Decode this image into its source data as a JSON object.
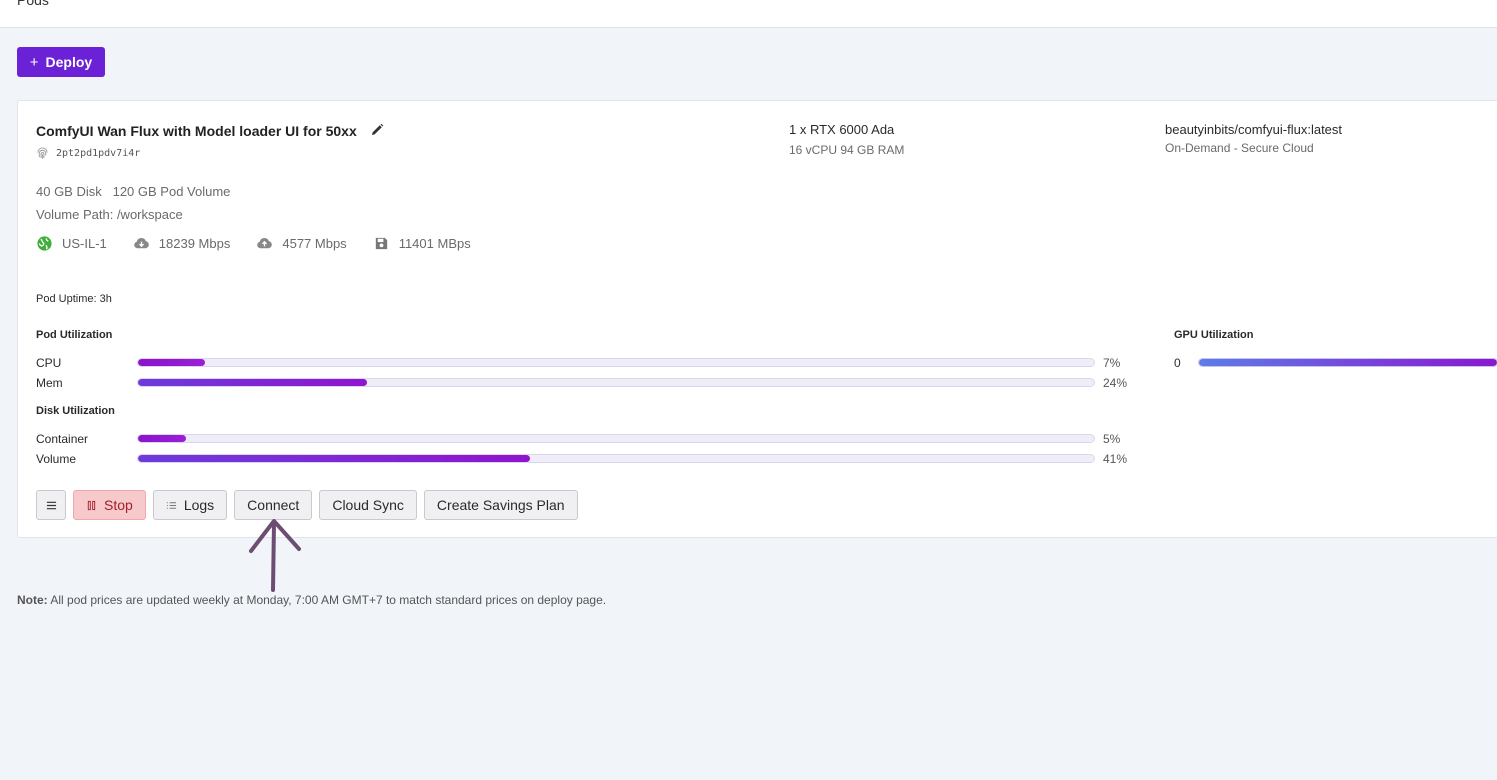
{
  "header": {
    "crumb": "Pods"
  },
  "deploy": {
    "plus": "+",
    "label": "Deploy"
  },
  "pod": {
    "name": "ComfyUI Wan Flux with Model loader UI for 50xx",
    "id": "2pt2pd1pdv7i4r",
    "gpu": "1 x RTX 6000 Ada",
    "cpu_ram": "16 vCPU 94 GB RAM",
    "image": "beautyinbits/comfyui-flux:latest",
    "cloud": "On-Demand - Secure Cloud",
    "disk": "40 GB Disk",
    "pod_volume": "120 GB Pod Volume",
    "volume_path": "Volume Path: /workspace",
    "region": "US-IL-1",
    "download": "18239 Mbps",
    "upload": "4577 Mbps",
    "disk_speed": "11401 MBps",
    "uptime": "Pod Uptime: 3h"
  },
  "utilization": {
    "pod_title": "Pod Utilization",
    "cpu": {
      "label": "CPU",
      "pct_text": "7%",
      "value": 7
    },
    "mem": {
      "label": "Mem",
      "pct_text": "24%",
      "value": 24
    },
    "disk_title": "Disk Utilization",
    "container": {
      "label": "Container",
      "pct_text": "5%",
      "value": 5
    },
    "volume": {
      "label": "Volume",
      "pct_text": "41%",
      "value": 41
    },
    "gpu_title": "GPU Utilization",
    "gpu0": {
      "label": "0"
    }
  },
  "actions": {
    "stop": "Stop",
    "logs": "Logs",
    "connect": "Connect",
    "cloud_sync": "Cloud Sync",
    "savings": "Create Savings Plan"
  },
  "note": {
    "prefix": "Note:",
    "text": "All pod prices are updated weekly at Monday, 7:00 AM GMT+7 to match standard prices on deploy page."
  },
  "colors": {
    "accent": "#6b21d6",
    "bar": "#8a13cc",
    "stop_bg": "#f8c9cb"
  }
}
